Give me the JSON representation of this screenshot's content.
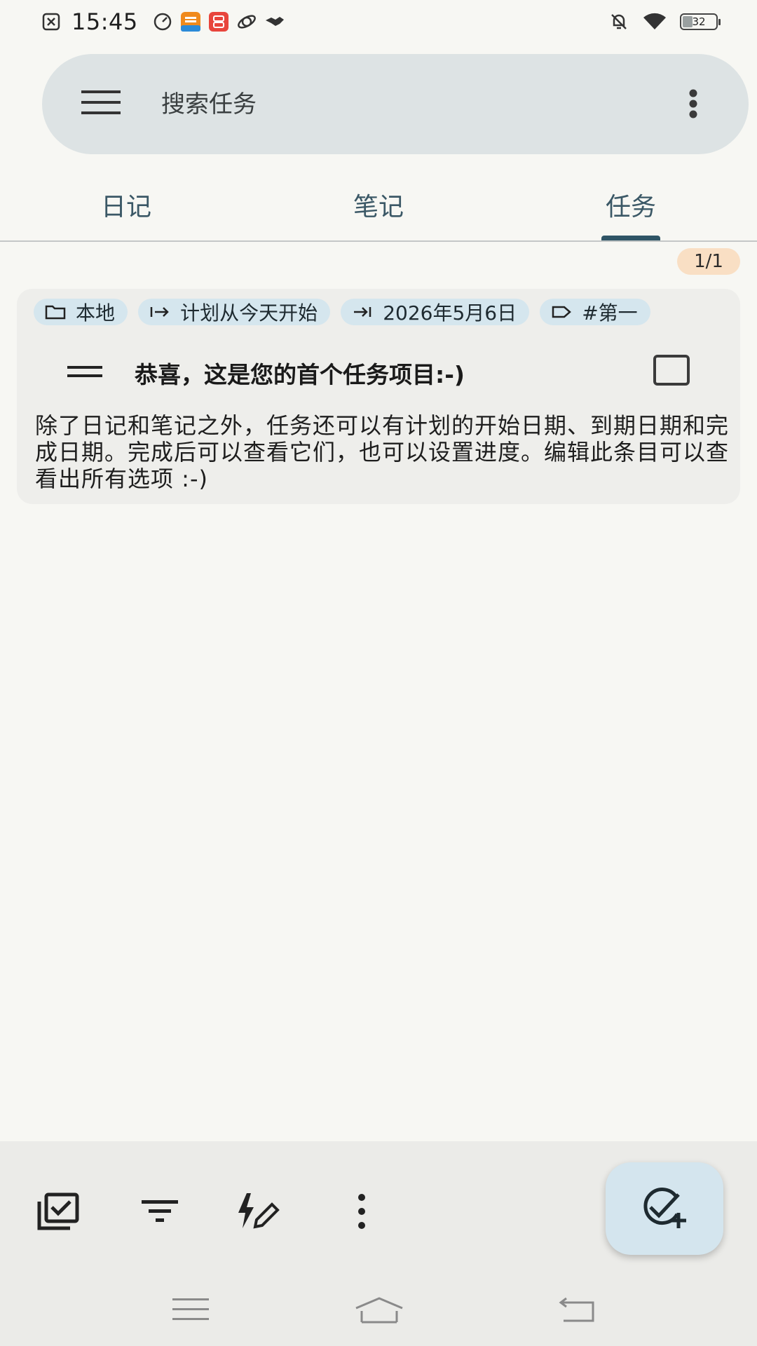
{
  "status_bar": {
    "time": "15:45",
    "battery": "32",
    "left_icons": [
      "close-box-icon",
      "speedometer-icon",
      "taobao-app-icon",
      "meituan-app-icon",
      "planet-icon",
      "handshake-icon"
    ],
    "right_icons": [
      "mute-bell-icon",
      "wifi-icon",
      "battery-icon"
    ]
  },
  "search": {
    "placeholder": "搜索任务"
  },
  "tabs": [
    {
      "label": "日记",
      "active": false
    },
    {
      "label": "笔记",
      "active": false
    },
    {
      "label": "任务",
      "active": true
    }
  ],
  "count_badge": "1/1",
  "task": {
    "chips": [
      {
        "icon": "folder-icon",
        "label": "本地"
      },
      {
        "icon": "start-arrow-icon",
        "label": "计划从今天开始"
      },
      {
        "icon": "due-arrow-icon",
        "label": "2026年5月6日"
      },
      {
        "icon": "tag-icon",
        "label": "#第一"
      }
    ],
    "title": "恭喜，这是您的首个任务项目:-)",
    "checked": false,
    "description": "除了日记和笔记之外，任务还可以有计划的开始日期、到期日期和完成日期。完成后可以查看它们，也可以设置进度。编辑此条目可以查看出所有选项 :-)"
  },
  "colors": {
    "background": "#f7f7f3",
    "search_bar": "#dde3e4",
    "chip": "#d5e6ee",
    "badge": "#f9dfc4",
    "accent": "#2f5566",
    "fab": "#d4e5ee"
  }
}
